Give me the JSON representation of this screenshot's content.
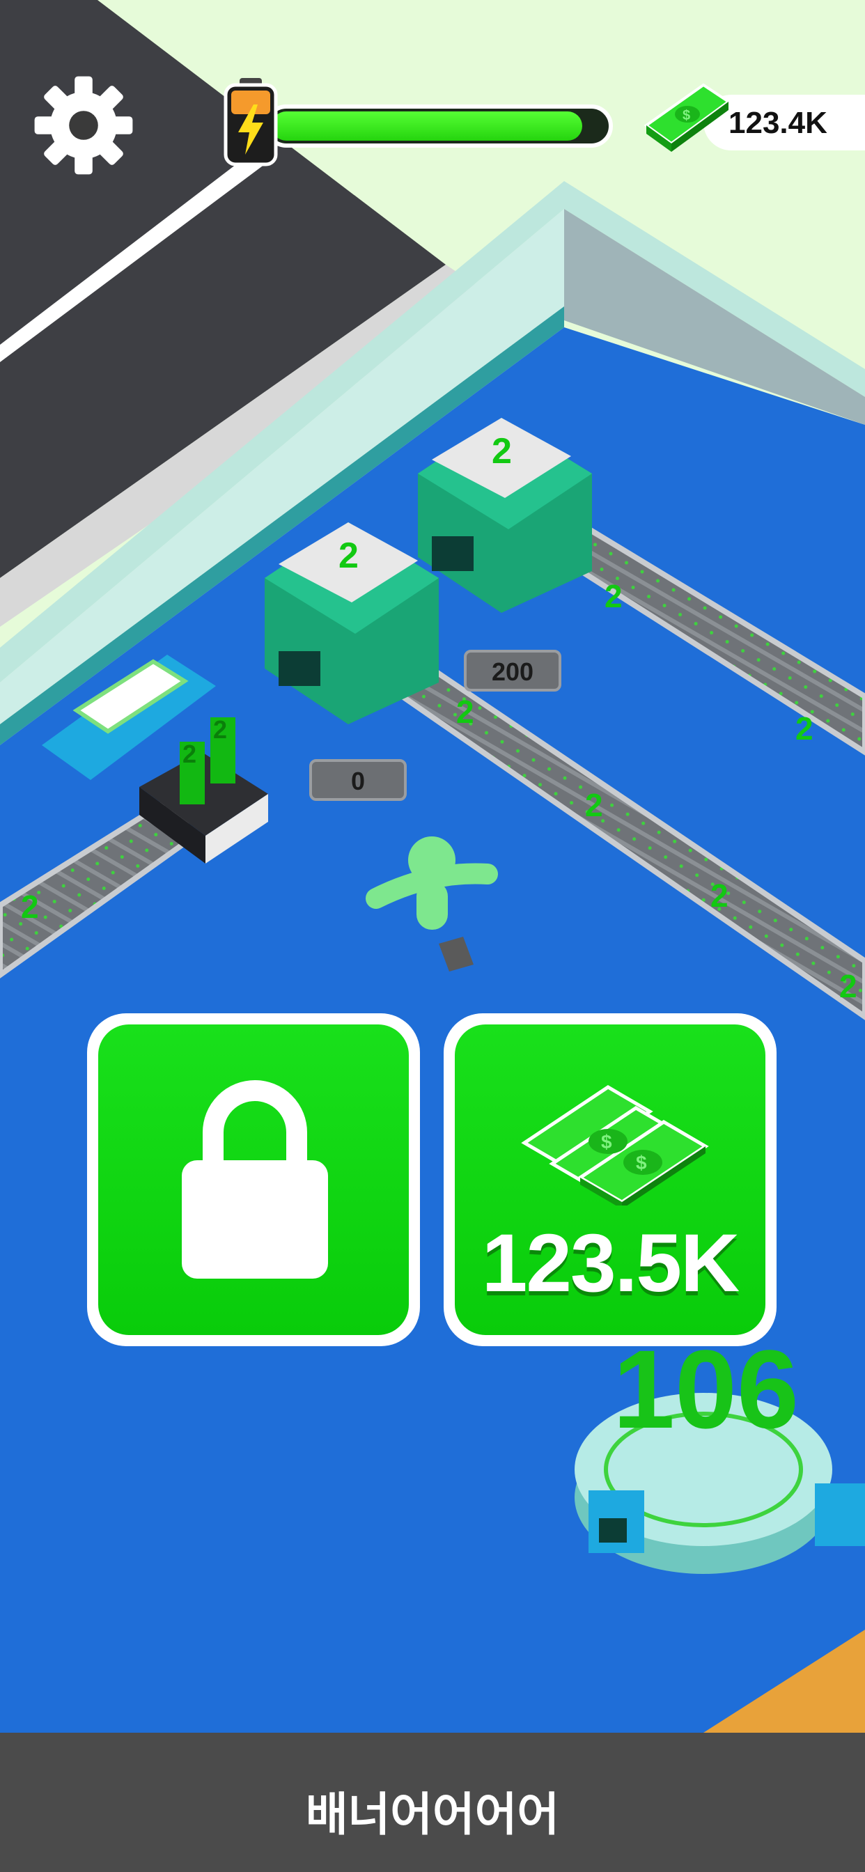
{
  "hud": {
    "settings_icon": "gear-icon",
    "energy_level": 0.93,
    "energy_icon": "battery-lightning-icon",
    "money": "123.4K",
    "money_icon": "cash-bill-icon"
  },
  "scene": {
    "machine_labels": [
      "2",
      "2"
    ],
    "conveyor_item_label": "2",
    "stack_items": [
      "2",
      "2"
    ],
    "counter_upper": "200",
    "counter_lower": "0",
    "platform_count": "106"
  },
  "panels": {
    "lock_icon": "padlock-icon",
    "cash_icon": "cash-stack-icon",
    "cash_value": "123.5K"
  },
  "banner": {
    "text": "배너어어어어"
  },
  "colors": {
    "floor": "#1f6ed8",
    "accent_green": "#0ed10f",
    "energy_green": "#3ff022",
    "banner": "#4b4b4b"
  }
}
